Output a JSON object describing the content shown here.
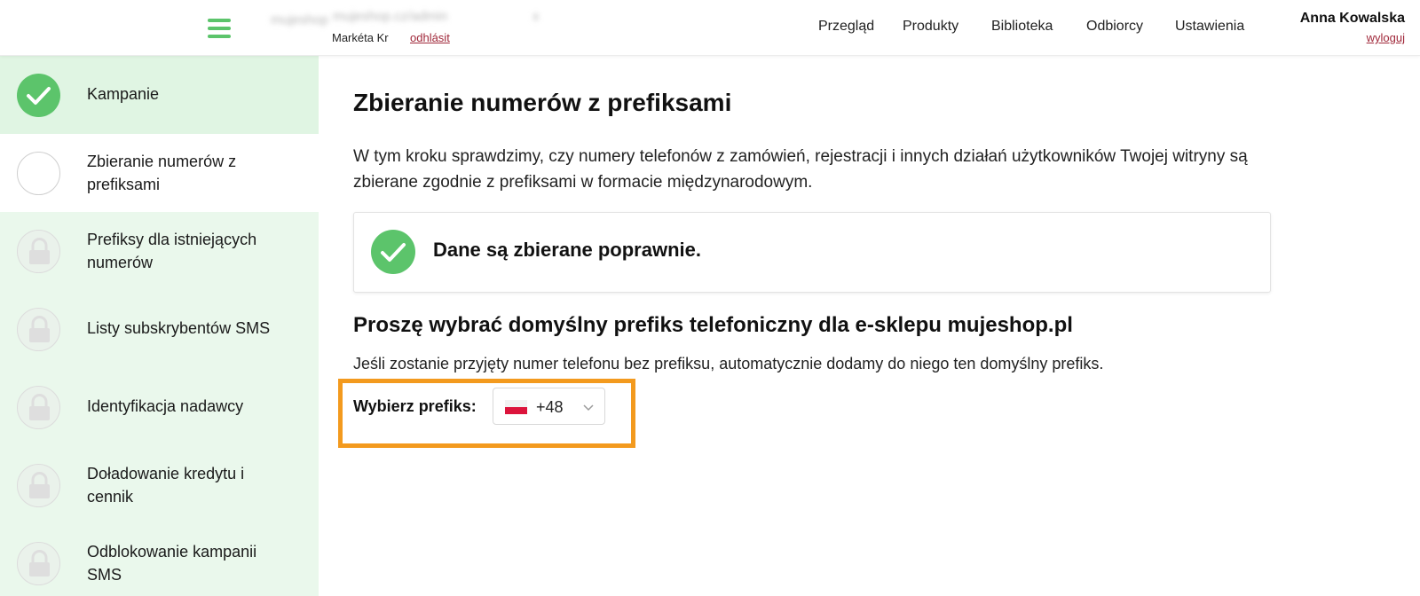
{
  "header": {
    "blurred_a": "mujeshop",
    "blurred_b": "mujeshop.cz/admin",
    "blurred_c": "x",
    "account_name": "Markéta Kr",
    "account_logout": "odhlásit",
    "nav": [
      "Przegląd",
      "Produkty",
      "Biblioteka",
      "Odbiorcy",
      "Ustawienia"
    ],
    "user_name": "Anna Kowalska",
    "user_logout": "wyloguj"
  },
  "sidebar": {
    "steps": [
      {
        "label": "Kampanie",
        "state": "done"
      },
      {
        "label": "Zbieranie numerów z prefiksami",
        "state": "current"
      },
      {
        "label": "Prefiksy dla istniejących numerów",
        "state": "locked"
      },
      {
        "label": "Listy subskrybentów SMS",
        "state": "locked"
      },
      {
        "label": "Identyfikacja nadawcy",
        "state": "locked"
      },
      {
        "label": "Doładowanie kredytu i cennik",
        "state": "locked"
      },
      {
        "label": "Odblokowanie kampanii SMS",
        "state": "locked"
      }
    ]
  },
  "main": {
    "title": "Zbieranie numerów z prefiksami",
    "description": "W tym kroku sprawdzimy, czy numery telefonów z zamówień, rejestracji i innych działań użytkowników Twojej witryny są zbierane zgodnie z prefiksami w formacie międzynarodowym.",
    "status_text": "Dane są zbierane poprawnie.",
    "subtitle": "Proszę wybrać domyślny prefiks telefoniczny dla e-sklepu mujeshop.pl",
    "hint": "Jeśli zostanie przyjęty numer telefonu bez prefiksu, automatycznie dodamy do niego ten domyślny prefiks.",
    "prefix_label": "Wybierz prefiks:",
    "prefix_value": "+48"
  },
  "colors": {
    "accent_green": "#5cc46b",
    "sidebar_bg": "#eaf8ec",
    "highlight_orange": "#f39a1e",
    "logout_red": "#a0283a"
  }
}
